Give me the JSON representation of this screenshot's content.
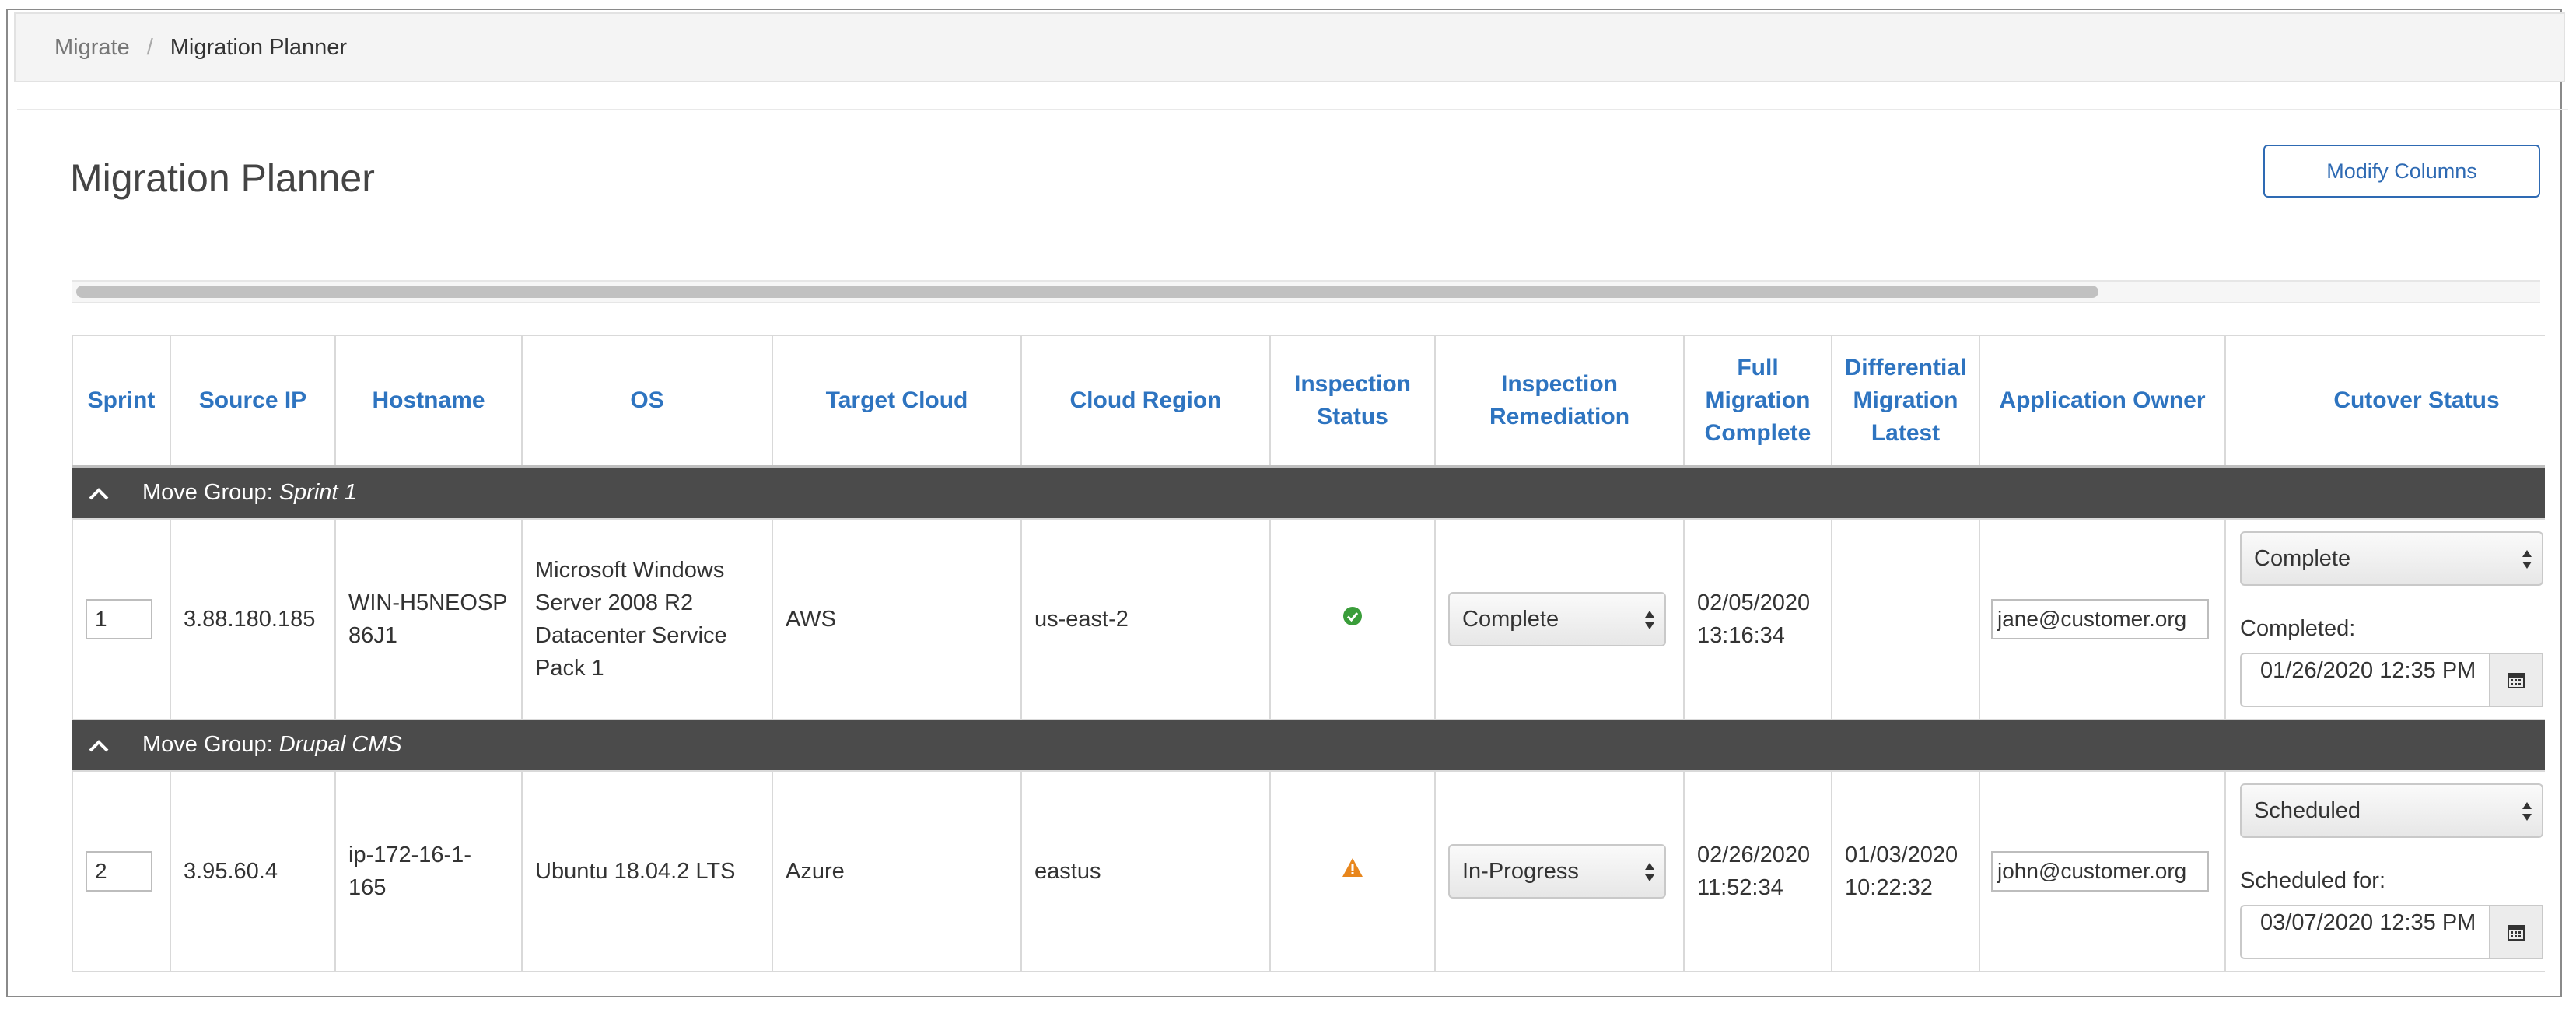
{
  "breadcrumb": {
    "items": [
      "Migrate",
      "Migration Planner"
    ],
    "separator": "/"
  },
  "page": {
    "title": "Migration Planner",
    "modify_columns_label": "Modify Columns"
  },
  "table": {
    "columns": [
      "Sprint",
      "Source IP",
      "Hostname",
      "OS",
      "Target Cloud",
      "Cloud Region",
      "Inspection Status",
      "Inspection Remediation",
      "Full Migration Complete",
      "Differential Migration Latest",
      "Application Owner",
      "Cutover Status"
    ],
    "groups": [
      {
        "label": "Move Group:",
        "name": "Sprint 1",
        "rows": [
          {
            "sprint": "1",
            "source_ip": "3.88.180.185",
            "hostname": "WIN-H5NEOSP86J1",
            "os": "Microsoft Windows Server 2008 R2 Datacenter Service Pack 1",
            "target_cloud": "AWS",
            "cloud_region": "us-east-2",
            "inspection_status_icon": "check-circle-icon",
            "remediation": "Complete",
            "full_migration_complete": "02/05/2020 13:16:34",
            "differential_migration_latest": "",
            "application_owner": "jane@customer.org",
            "cutover_status": "Complete",
            "cutover_date_label": "Completed:",
            "cutover_date": "01/26/2020 12:35 PM"
          }
        ]
      },
      {
        "label": "Move Group:",
        "name": "Drupal CMS",
        "rows": [
          {
            "sprint": "2",
            "source_ip": "3.95.60.4",
            "hostname": "ip-172-16-1-165",
            "os": "Ubuntu 18.04.2 LTS",
            "target_cloud": "Azure",
            "cloud_region": "eastus",
            "inspection_status_icon": "warning-icon",
            "remediation": "In-Progress",
            "full_migration_complete": "02/26/2020 11:52:34",
            "differential_migration_latest": "01/03/2020 10:22:32",
            "application_owner": "john@customer.org",
            "cutover_status": "Scheduled",
            "cutover_date_label": "Scheduled for:",
            "cutover_date": "03/07/2020 12:35 PM"
          }
        ]
      }
    ]
  },
  "colors": {
    "accent": "#2e74c0",
    "group_header_bg": "#4b4b4b",
    "success": "#3a9d3a",
    "warning": "#e8861c"
  }
}
